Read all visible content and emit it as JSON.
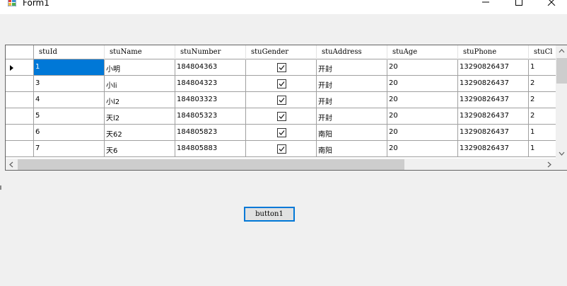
{
  "window": {
    "title": "Form1"
  },
  "grid": {
    "columns": [
      "stuId",
      "stuName",
      "stuNumber",
      "stuGender",
      "stuAddress",
      "stuAge",
      "stuPhone",
      "stuCl"
    ],
    "rows": [
      {
        "stuId": "1",
        "stuName": "小明",
        "stuNumber": "184804363",
        "stuGender": true,
        "stuAddress": "开封",
        "stuAge": "20",
        "stuPhone": "13290826437",
        "stuCl": "1"
      },
      {
        "stuId": "3",
        "stuName": "小li",
        "stuNumber": "184804323",
        "stuGender": true,
        "stuAddress": "开封",
        "stuAge": "20",
        "stuPhone": "13290826437",
        "stuCl": "2"
      },
      {
        "stuId": "4",
        "stuName": "小l2",
        "stuNumber": "184803323",
        "stuGender": true,
        "stuAddress": "开封",
        "stuAge": "20",
        "stuPhone": "13290826437",
        "stuCl": "2"
      },
      {
        "stuId": "5",
        "stuName": "天l2",
        "stuNumber": "184805323",
        "stuGender": true,
        "stuAddress": "开封",
        "stuAge": "20",
        "stuPhone": "13290826437",
        "stuCl": "2"
      },
      {
        "stuId": "6",
        "stuName": "天62",
        "stuNumber": "184805823",
        "stuGender": true,
        "stuAddress": "南阳",
        "stuAge": "20",
        "stuPhone": "13290826437",
        "stuCl": "1"
      },
      {
        "stuId": "7",
        "stuName": "天6",
        "stuNumber": "184805883",
        "stuGender": true,
        "stuAddress": "南阳",
        "stuAge": "20",
        "stuPhone": "13290826437",
        "stuCl": "1"
      }
    ],
    "selected_row_index": 0,
    "selection_color": "#0078d7"
  },
  "button1": {
    "label": "button1"
  }
}
